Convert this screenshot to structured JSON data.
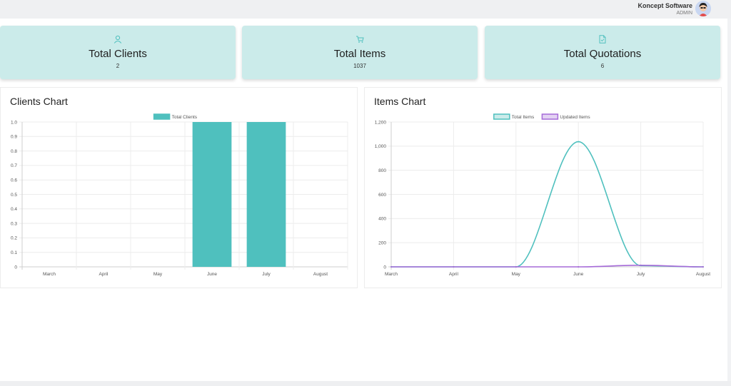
{
  "header": {
    "user_name": "Koncept Software",
    "user_role": "ADMIN"
  },
  "stats": [
    {
      "title": "Total Clients",
      "value": "2",
      "icon": "user-icon"
    },
    {
      "title": "Total Items",
      "value": "1037",
      "icon": "cart-icon"
    },
    {
      "title": "Total Quotations",
      "value": "6",
      "icon": "document-icon"
    }
  ],
  "colors": {
    "accent": "#4fc0be",
    "card_bg": "#cbebea",
    "purple": "#a56ad8"
  },
  "chart_data": [
    {
      "type": "bar",
      "title": "Clients Chart",
      "categories": [
        "March",
        "April",
        "May",
        "June",
        "July",
        "August"
      ],
      "series": [
        {
          "name": "Total Clients",
          "values": [
            0,
            0,
            0,
            1,
            1,
            0
          ]
        }
      ],
      "yticks": [
        "0",
        "0.1",
        "0.2",
        "0.3",
        "0.4",
        "0.5",
        "0.6",
        "0.7",
        "0.8",
        "0.9",
        "1.0"
      ],
      "ylim": [
        0,
        1
      ],
      "legend": "top",
      "grid": true
    },
    {
      "type": "line",
      "title": "Items Chart",
      "categories": [
        "March",
        "April",
        "May",
        "June",
        "July",
        "August"
      ],
      "series": [
        {
          "name": "Total Items",
          "values": [
            0,
            0,
            0,
            1037,
            10,
            0
          ]
        },
        {
          "name": "Updated Items",
          "values": [
            0,
            0,
            0,
            0,
            13,
            0
          ]
        }
      ],
      "yticks": [
        "0",
        "200",
        "400",
        "600",
        "800",
        "1,000",
        "1,200"
      ],
      "ylim": [
        0,
        1200
      ],
      "legend": "top",
      "grid": true
    }
  ]
}
